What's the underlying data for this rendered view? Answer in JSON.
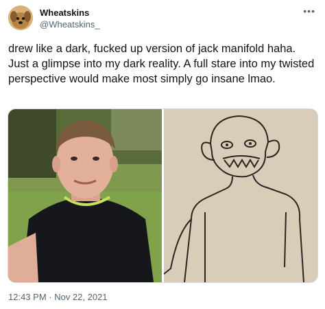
{
  "user": {
    "name": "Wheatskins",
    "handle": "@Wheatskins_"
  },
  "tweet": {
    "text": "drew like a dark, fucked up version of jack manifold haha. Just a glimpse into my dark reality. A full stare into my twisted perspective would make most simply go insane lmao.",
    "timestamp": "12:43 PM · Nov 22, 2021"
  },
  "icons": {
    "more": "more-options-icon",
    "avatar": "dog-avatar-icon"
  },
  "colors": {
    "text": "#0f1419",
    "secondary": "#536471",
    "border": "#cfd9de",
    "background": "#ffffff"
  }
}
